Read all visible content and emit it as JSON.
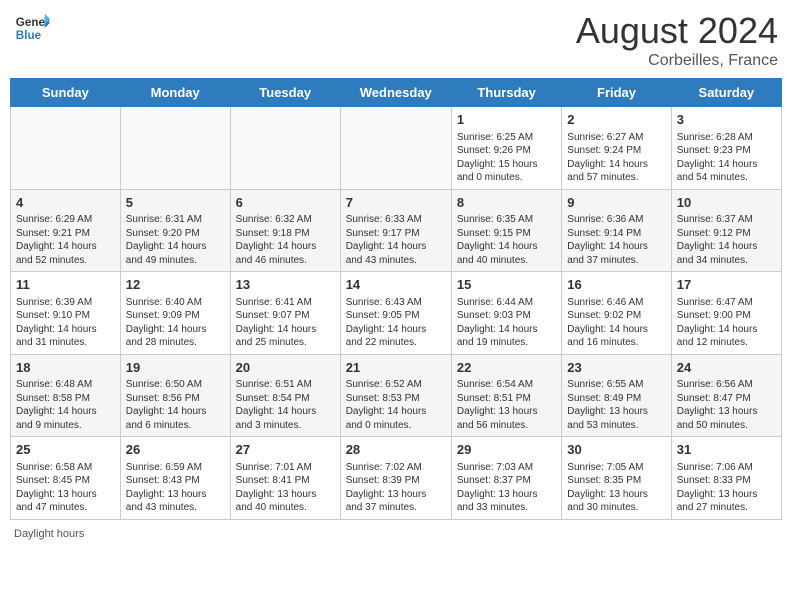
{
  "header": {
    "logo_line1": "General",
    "logo_line2": "Blue",
    "month_year": "August 2024",
    "location": "Corbeilles, France"
  },
  "days_of_week": [
    "Sunday",
    "Monday",
    "Tuesday",
    "Wednesday",
    "Thursday",
    "Friday",
    "Saturday"
  ],
  "footer": {
    "daylight_hours": "Daylight hours"
  },
  "weeks": [
    [
      {
        "day": "",
        "info": ""
      },
      {
        "day": "",
        "info": ""
      },
      {
        "day": "",
        "info": ""
      },
      {
        "day": "",
        "info": ""
      },
      {
        "day": "1",
        "info": "Sunrise: 6:25 AM\nSunset: 9:26 PM\nDaylight: 15 hours\nand 0 minutes."
      },
      {
        "day": "2",
        "info": "Sunrise: 6:27 AM\nSunset: 9:24 PM\nDaylight: 14 hours\nand 57 minutes."
      },
      {
        "day": "3",
        "info": "Sunrise: 6:28 AM\nSunset: 9:23 PM\nDaylight: 14 hours\nand 54 minutes."
      }
    ],
    [
      {
        "day": "4",
        "info": "Sunrise: 6:29 AM\nSunset: 9:21 PM\nDaylight: 14 hours\nand 52 minutes."
      },
      {
        "day": "5",
        "info": "Sunrise: 6:31 AM\nSunset: 9:20 PM\nDaylight: 14 hours\nand 49 minutes."
      },
      {
        "day": "6",
        "info": "Sunrise: 6:32 AM\nSunset: 9:18 PM\nDaylight: 14 hours\nand 46 minutes."
      },
      {
        "day": "7",
        "info": "Sunrise: 6:33 AM\nSunset: 9:17 PM\nDaylight: 14 hours\nand 43 minutes."
      },
      {
        "day": "8",
        "info": "Sunrise: 6:35 AM\nSunset: 9:15 PM\nDaylight: 14 hours\nand 40 minutes."
      },
      {
        "day": "9",
        "info": "Sunrise: 6:36 AM\nSunset: 9:14 PM\nDaylight: 14 hours\nand 37 minutes."
      },
      {
        "day": "10",
        "info": "Sunrise: 6:37 AM\nSunset: 9:12 PM\nDaylight: 14 hours\nand 34 minutes."
      }
    ],
    [
      {
        "day": "11",
        "info": "Sunrise: 6:39 AM\nSunset: 9:10 PM\nDaylight: 14 hours\nand 31 minutes."
      },
      {
        "day": "12",
        "info": "Sunrise: 6:40 AM\nSunset: 9:09 PM\nDaylight: 14 hours\nand 28 minutes."
      },
      {
        "day": "13",
        "info": "Sunrise: 6:41 AM\nSunset: 9:07 PM\nDaylight: 14 hours\nand 25 minutes."
      },
      {
        "day": "14",
        "info": "Sunrise: 6:43 AM\nSunset: 9:05 PM\nDaylight: 14 hours\nand 22 minutes."
      },
      {
        "day": "15",
        "info": "Sunrise: 6:44 AM\nSunset: 9:03 PM\nDaylight: 14 hours\nand 19 minutes."
      },
      {
        "day": "16",
        "info": "Sunrise: 6:46 AM\nSunset: 9:02 PM\nDaylight: 14 hours\nand 16 minutes."
      },
      {
        "day": "17",
        "info": "Sunrise: 6:47 AM\nSunset: 9:00 PM\nDaylight: 14 hours\nand 12 minutes."
      }
    ],
    [
      {
        "day": "18",
        "info": "Sunrise: 6:48 AM\nSunset: 8:58 PM\nDaylight: 14 hours\nand 9 minutes."
      },
      {
        "day": "19",
        "info": "Sunrise: 6:50 AM\nSunset: 8:56 PM\nDaylight: 14 hours\nand 6 minutes."
      },
      {
        "day": "20",
        "info": "Sunrise: 6:51 AM\nSunset: 8:54 PM\nDaylight: 14 hours\nand 3 minutes."
      },
      {
        "day": "21",
        "info": "Sunrise: 6:52 AM\nSunset: 8:53 PM\nDaylight: 14 hours\nand 0 minutes."
      },
      {
        "day": "22",
        "info": "Sunrise: 6:54 AM\nSunset: 8:51 PM\nDaylight: 13 hours\nand 56 minutes."
      },
      {
        "day": "23",
        "info": "Sunrise: 6:55 AM\nSunset: 8:49 PM\nDaylight: 13 hours\nand 53 minutes."
      },
      {
        "day": "24",
        "info": "Sunrise: 6:56 AM\nSunset: 8:47 PM\nDaylight: 13 hours\nand 50 minutes."
      }
    ],
    [
      {
        "day": "25",
        "info": "Sunrise: 6:58 AM\nSunset: 8:45 PM\nDaylight: 13 hours\nand 47 minutes."
      },
      {
        "day": "26",
        "info": "Sunrise: 6:59 AM\nSunset: 8:43 PM\nDaylight: 13 hours\nand 43 minutes."
      },
      {
        "day": "27",
        "info": "Sunrise: 7:01 AM\nSunset: 8:41 PM\nDaylight: 13 hours\nand 40 minutes."
      },
      {
        "day": "28",
        "info": "Sunrise: 7:02 AM\nSunset: 8:39 PM\nDaylight: 13 hours\nand 37 minutes."
      },
      {
        "day": "29",
        "info": "Sunrise: 7:03 AM\nSunset: 8:37 PM\nDaylight: 13 hours\nand 33 minutes."
      },
      {
        "day": "30",
        "info": "Sunrise: 7:05 AM\nSunset: 8:35 PM\nDaylight: 13 hours\nand 30 minutes."
      },
      {
        "day": "31",
        "info": "Sunrise: 7:06 AM\nSunset: 8:33 PM\nDaylight: 13 hours\nand 27 minutes."
      }
    ]
  ]
}
